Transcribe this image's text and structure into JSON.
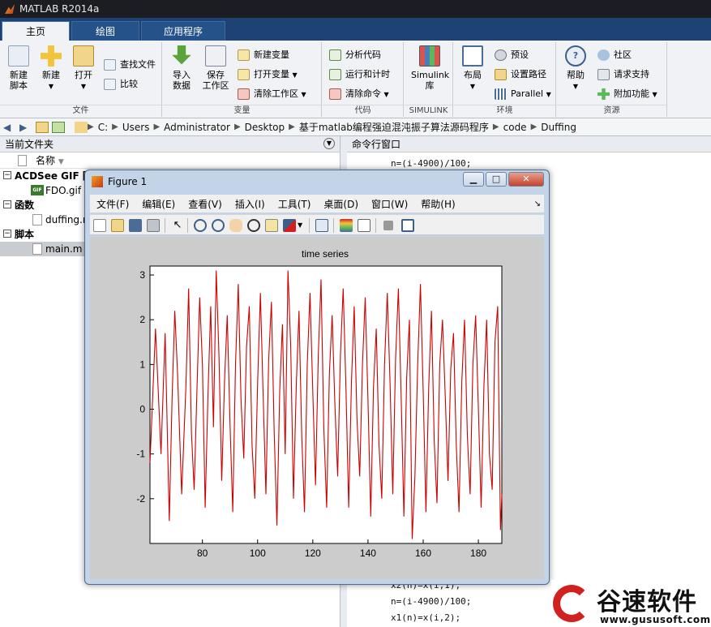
{
  "app": {
    "title": "MATLAB R2014a"
  },
  "tabs": [
    {
      "label": "主页"
    },
    {
      "label": "绘图"
    },
    {
      "label": "应用程序"
    }
  ],
  "ribbon": {
    "file_group": {
      "label": "文件",
      "new_script": "新建\n脚本",
      "new": "新建",
      "open": "打开",
      "find_files": "查找文件",
      "compare": "比较"
    },
    "variable_group": {
      "label": "变量",
      "import": "导入\n数据",
      "save_ws": "保存\n工作区",
      "new_var": "新建变量",
      "open_var": "打开变量",
      "clear_ws": "清除工作区"
    },
    "code_group": {
      "label": "代码",
      "analyze": "分析代码",
      "run_time": "运行和计时",
      "clear_cmd": "清除命令"
    },
    "simulink_group": {
      "label": "SIMULINK",
      "lib": "Simulink\n库"
    },
    "env_group": {
      "label": "环境",
      "layout": "布局",
      "prefs": "预设",
      "set_path": "设置路径",
      "parallel": "Parallel"
    },
    "resources_group": {
      "label": "资源",
      "help": "帮助",
      "community": "社区",
      "request_support": "请求支持",
      "addons": "附加功能"
    }
  },
  "address": {
    "segments": [
      "C:",
      "Users",
      "Administrator",
      "Desktop",
      "基于matlab编程强迫混沌振子算法源码程序",
      "code",
      "Duffing"
    ]
  },
  "current_folder": {
    "title": "当前文件夹",
    "name_col": "名称",
    "groups": [
      {
        "label": "ACDSee GIF 图",
        "files": [
          "FDO.gif"
        ]
      },
      {
        "label": "函数",
        "files": [
          "duffing.m"
        ]
      },
      {
        "label": "脚本",
        "files": [
          "main.m"
        ]
      }
    ]
  },
  "command_window": {
    "title": "命令行窗口",
    "lines_top": [
      "n=(i-4900)/100;"
    ],
    "lines_bottom": [
      "x2(n)=x(i,1);",
      "n=(i-4900)/100;",
      "x1(n)=x(i,2);"
    ]
  },
  "figure": {
    "title": "Figure 1",
    "menu": [
      "文件(F)",
      "编辑(E)",
      "查看(V)",
      "插入(I)",
      "工具(T)",
      "桌面(D)",
      "窗口(W)",
      "帮助(H)"
    ]
  },
  "chart_data": {
    "type": "line",
    "title": "time series",
    "xlabel": "",
    "ylabel": "",
    "xlim": [
      61,
      188.5
    ],
    "ylim": [
      -3,
      3.2
    ],
    "xticks": [
      80,
      100,
      120,
      140,
      160,
      180
    ],
    "yticks": [
      -2,
      -1,
      0,
      1,
      2,
      3
    ],
    "line_color": "#cc0000",
    "grid": false,
    "series": [
      {
        "x": [
          61,
          62,
          63,
          64,
          65,
          66.5,
          68,
          69,
          70,
          71,
          72.5,
          74,
          75,
          76,
          77,
          78,
          79,
          80,
          81,
          82,
          83,
          84,
          85,
          86,
          87,
          88,
          89,
          90,
          91,
          92,
          93,
          94,
          95,
          96,
          97,
          98,
          99,
          100,
          101,
          102,
          103,
          104,
          105,
          106,
          107,
          108,
          109,
          110,
          111,
          112,
          113,
          114,
          115,
          116,
          117,
          118,
          119,
          120,
          121,
          122,
          123,
          124,
          125,
          126,
          127,
          128,
          129,
          130,
          131,
          132,
          133,
          134,
          135,
          136,
          137,
          138,
          139,
          140,
          141,
          142,
          143,
          144,
          145,
          146,
          147,
          148,
          149,
          150,
          151,
          152,
          153,
          154,
          155,
          156,
          157,
          158,
          159,
          160,
          161,
          162,
          163,
          164,
          165,
          166,
          167,
          168,
          169,
          170,
          171,
          172,
          173,
          174,
          175,
          176,
          177,
          178,
          179,
          180,
          181,
          182,
          183,
          184,
          185,
          186,
          187,
          188,
          188.5
        ],
        "y": [
          -1.2,
          0.3,
          1.8,
          0.4,
          -1.0,
          1.7,
          -2.5,
          0.2,
          2.2,
          0.8,
          -1.9,
          0.5,
          2.7,
          -0.5,
          -1.8,
          0.4,
          2.5,
          1.0,
          -2.2,
          0.3,
          2.3,
          -0.4,
          3.1,
          1.2,
          -1.6,
          0.6,
          2.1,
          -0.3,
          -2.3,
          1.0,
          2.8,
          0.2,
          -1.1,
          1.4,
          2.3,
          -0.8,
          -2.0,
          0.6,
          2.6,
          0.3,
          -1.9,
          1.1,
          2.4,
          -0.5,
          -2.6,
          0.4,
          1.9,
          -1.0,
          3.1,
          1.4,
          -2.0,
          0.5,
          2.2,
          -0.6,
          -2.3,
          1.0,
          2.6,
          0.4,
          -1.7,
          1.2,
          2.9,
          -0.4,
          -2.2,
          0.8,
          2.1,
          0.1,
          -1.5,
          1.2,
          2.7,
          0.5,
          -2.2,
          0.6,
          2.3,
          -0.2,
          -1.5,
          1.0,
          2.5,
          0.2,
          -2.4,
          0.5,
          1.8,
          -0.8,
          -2.0,
          1.0,
          2.6,
          0.6,
          -1.9,
          1.1,
          2.7,
          0.3,
          -2.4,
          0.7,
          2.0,
          -2.9,
          -1.5,
          1.0,
          2.8,
          0.4,
          -2.3,
          0.5,
          2.2,
          -0.7,
          -2.1,
          1.0,
          2.0,
          0.3,
          -1.6,
          0.9,
          1.7,
          -0.8,
          -2.3,
          0.6,
          2.0,
          -0.6,
          -1.9,
          1.0,
          2.1,
          0.0,
          -2.2,
          0.5,
          2.0,
          -1.0,
          -1.8,
          1.5,
          2.3,
          -2.7,
          -1.9
        ]
      }
    ]
  },
  "watermark": {
    "text": "谷速软件",
    "url": "www.gususoft.com"
  },
  "colors": {
    "tabbar": "#1e4273",
    "accent_red": "#d21f1f",
    "plot_line": "#cc0000"
  },
  "icons": {
    "new_script": "new-script-icon",
    "new": "plus-icon",
    "open": "folder-icon",
    "import": "import-arrow-icon",
    "save": "save-workspace-icon",
    "simulink": "simulink-icon",
    "layout": "layout-icon",
    "help": "help-icon"
  }
}
